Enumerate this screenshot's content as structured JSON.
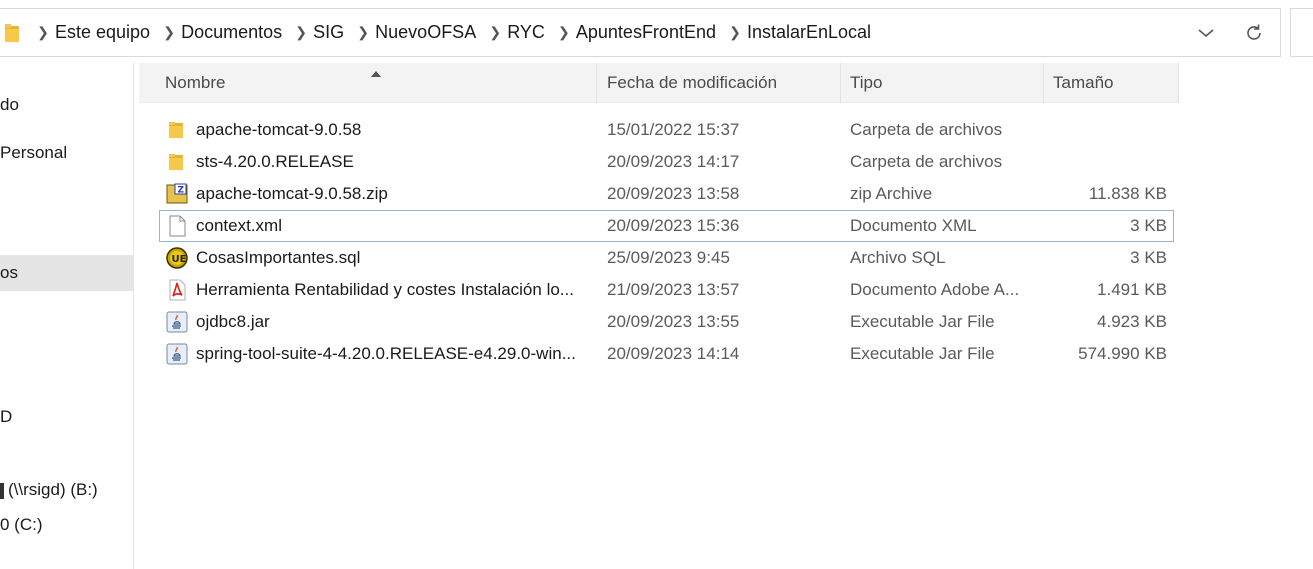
{
  "address_bar": {
    "crumbs": [
      "Este equipo",
      "Documentos",
      "SIG",
      "NuevoOFSA",
      "RYC",
      "ApuntesFrontEnd",
      "InstalarEnLocal"
    ],
    "dropdown_icon": "chevron-down-icon",
    "refresh_icon": "refresh-icon"
  },
  "navpane": {
    "items": [
      {
        "label": "do",
        "selected": false
      },
      {
        "label": "Personal",
        "selected": false
      },
      {
        "label": "os",
        "selected": true
      },
      {
        "label": "D",
        "selected": false
      },
      {
        "label": "(\\\\rsigd) (B:)",
        "selected": false
      },
      {
        "label": "0 (C:)",
        "selected": false
      }
    ]
  },
  "columns": {
    "name": "Nombre",
    "date": "Fecha de modificación",
    "type": "Tipo",
    "size": "Tamaño"
  },
  "files": [
    {
      "name": "apache-tomcat-9.0.58",
      "date": "15/01/2022 15:37",
      "type": "Carpeta de archivos",
      "size": "",
      "icon": "folder-icon"
    },
    {
      "name": "sts-4.20.0.RELEASE",
      "date": "20/09/2023 14:17",
      "type": "Carpeta de archivos",
      "size": "",
      "icon": "folder-icon"
    },
    {
      "name": "apache-tomcat-9.0.58.zip",
      "date": "20/09/2023 13:58",
      "type": "zip Archive",
      "size": "11.838 KB",
      "icon": "zip-archive-icon"
    },
    {
      "name": "context.xml",
      "date": "20/09/2023 15:36",
      "type": "Documento XML",
      "size": "3 KB",
      "icon": "document-icon"
    },
    {
      "name": "CosasImportantes.sql",
      "date": "25/09/2023 9:45",
      "type": "Archivo SQL",
      "size": "3 KB",
      "icon": "ultraedit-icon"
    },
    {
      "name": "Herramienta Rentabilidad y costes Instalación lo...",
      "date": "21/09/2023 13:57",
      "type": "Documento Adobe A...",
      "size": "1.491 KB",
      "icon": "pdf-icon"
    },
    {
      "name": "ojdbc8.jar",
      "date": "20/09/2023 13:55",
      "type": "Executable Jar File",
      "size": "4.923 KB",
      "icon": "java-jar-icon"
    },
    {
      "name": "spring-tool-suite-4-4.20.0.RELEASE-e4.29.0-win...",
      "date": "20/09/2023 14:14",
      "type": "Executable Jar File",
      "size": "574.990 KB",
      "icon": "java-jar-icon"
    }
  ]
}
